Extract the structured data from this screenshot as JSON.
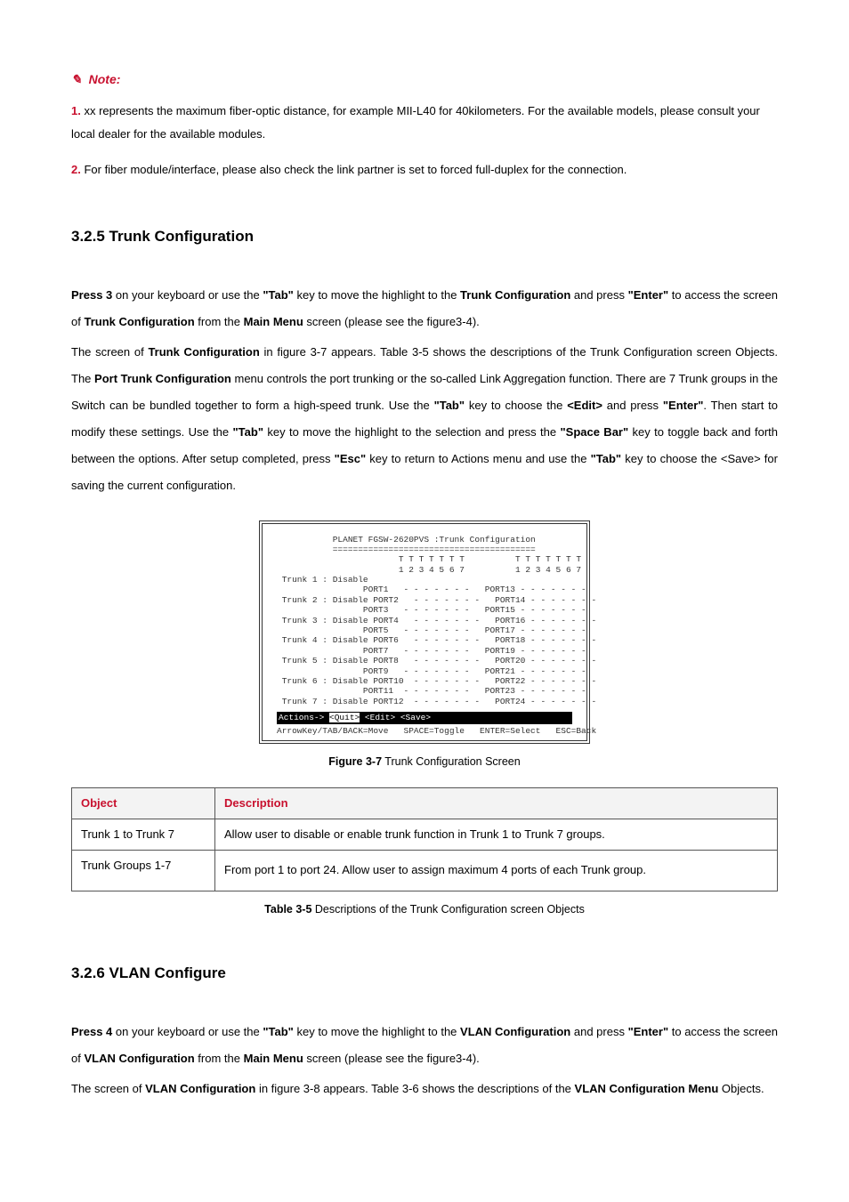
{
  "note": {
    "label": "Note:",
    "items": [
      {
        "num": "1.",
        "text": "xx represents the maximum fiber-optic distance, for example MII-L40 for 40kilometers. For the available models, please consult your local dealer for the available modules."
      },
      {
        "num": "2.",
        "text": "For fiber module/interface, please also check the link partner is set to forced full-duplex for the connection."
      }
    ]
  },
  "section325": {
    "heading": "3.2.5 Trunk Configuration",
    "para1": {
      "t1": "Press 3",
      "t2": " on your keyboard or use the ",
      "t3": "\"Tab\"",
      "t4": " key to move the highlight to the ",
      "t5": "Trunk Configuration",
      "t6": " and press ",
      "t7": "\"Enter\"",
      "t8": " to access the screen of ",
      "t9": "Trunk Configuration",
      "t10": " from the ",
      "t11": "Main Menu",
      "t12": " screen (please see the figure3-4)."
    },
    "para2": {
      "t1": "The screen of ",
      "t2": "Trunk Configuration",
      "t3": " in figure 3-7 appears. Table 3-5 shows the descriptions of the Trunk Configuration screen Objects. The ",
      "t4": "Port Trunk Configuration",
      "t5": " menu controls the port trunking or the so-called Link Aggregation function. There are 7 Trunk groups in the Switch can be bundled together to form a high-speed trunk. Use the ",
      "t6": "\"Tab\"",
      "t7": " key to choose the ",
      "t8": "<Edit>",
      "t9": " and press ",
      "t10": "\"Enter\"",
      "t11": ". Then start to modify these settings.   Use the ",
      "t12": "\"Tab\"",
      "t13": " key to move the highlight to the selection and press the ",
      "t14": "\"Space Bar\"",
      "t15": " key to toggle back and forth between the options. After setup completed, press ",
      "t16": "\"Esc\"",
      "t17": " key to return to Actions menu and use the ",
      "t18": "\"Tab\"",
      "t19": " key to choose the <Save> for saving the current configuration."
    }
  },
  "terminal": {
    "header": "           PLANET FGSW-2620PVS :Trunk Configuration\n           ========================================\n",
    "cols1": "                        T T T T T T T          T T T T T T T\n                        1 2 3 4 5 6 7          1 2 3 4 5 6 7",
    "body": " Trunk 1 : Disable\n                 PORT1   - - - - - - -   PORT13 - - - - - - -\n Trunk 2 : Disable PORT2   - - - - - - -   PORT14 - - - - - - -\n                 PORT3   - - - - - - -   PORT15 - - - - - - -\n Trunk 3 : Disable PORT4   - - - - - - -   PORT16 - - - - - - -\n                 PORT5   - - - - - - -   PORT17 - - - - - - -\n Trunk 4 : Disable PORT6   - - - - - - -   PORT18 - - - - - - -\n                 PORT7   - - - - - - -   PORT19 - - - - - - -\n Trunk 5 : Disable PORT8   - - - - - - -   PORT20 - - - - - - -\n                 PORT9   - - - - - - -   PORT21 - - - - - - -\n Trunk 6 : Disable PORT10  - - - - - - -   PORT22 - - - - - - -\n                 PORT11  - - - - - - -   PORT23 - - - - - - -\n Trunk 7 : Disable PORT12  - - - - - - -   PORT24 - - - - - - -",
    "actions_pre": "Actions-> ",
    "actions_quit": "<Quit>",
    "actions_edit": "    <Edit>",
    "actions_save": "    <Save>",
    "footer": "ArrowKey/TAB/BACK=Move   SPACE=Toggle   ENTER=Select   ESC=Back"
  },
  "figure37": {
    "bold": "Figure 3-7",
    "rest": " Trunk Configuration Screen"
  },
  "table35": {
    "head_obj": "Object",
    "head_desc": "Description",
    "rows": [
      {
        "obj": "Trunk 1 to Trunk 7",
        "desc": "Allow user to disable or enable trunk function in Trunk 1 to Trunk 7 groups."
      },
      {
        "obj": "Trunk Groups 1-7",
        "desc": "From port 1 to port 24. Allow user to assign maximum 4 ports of each Trunk group."
      }
    ],
    "caption_bold": "Table 3-5",
    "caption_rest": " Descriptions of the Trunk Configuration screen Objects"
  },
  "section326": {
    "heading": "3.2.6 VLAN Configure",
    "para1": {
      "t1": "Press 4",
      "t2": " on your keyboard or use the ",
      "t3": "\"Tab\"",
      "t4": " key to move the highlight to the ",
      "t5": "VLAN Configuration",
      "t6": " and press ",
      "t7": "\"Enter\"",
      "t8": " to access the screen of ",
      "t9": "VLAN Configuration",
      "t10": " from the ",
      "t11": "Main Menu",
      "t12": " screen (please see the figure3-4)."
    },
    "para2": {
      "t1": "The screen of ",
      "t2": "VLAN Configuration",
      "t3": " in figure 3-8 appears. Table 3-6 shows the descriptions of the ",
      "t4": "VLAN Configuration Menu",
      "t5": " Objects."
    }
  }
}
